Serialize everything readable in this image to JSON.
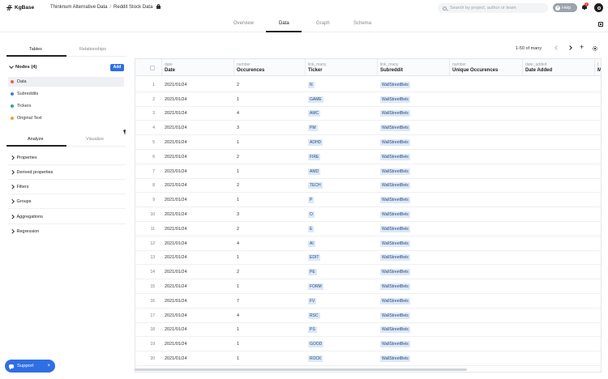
{
  "app": {
    "name": "KgBase"
  },
  "breadcrumb": {
    "project": "Thinknum Alternative Data",
    "separator": "/",
    "dataset": "Reddit Stock Data"
  },
  "search": {
    "placeholder": "Search by project, author or team"
  },
  "help": {
    "label": "Help",
    "icon": "?"
  },
  "notifications": {
    "count": "2"
  },
  "main_tabs": [
    {
      "label": "Overview"
    },
    {
      "label": "Data"
    },
    {
      "label": "Graph"
    },
    {
      "label": "Schema"
    }
  ],
  "main_tabs_active": "Data",
  "panel_tabs": [
    {
      "label": "Tables"
    },
    {
      "label": "Relationships"
    }
  ],
  "nodes": {
    "header": "Nodes (4)",
    "add_label": "Add",
    "items": [
      {
        "label": "Data",
        "color": "#e85d5d"
      },
      {
        "label": "Subreddits",
        "color": "#3f7fd9"
      },
      {
        "label": "Tickers",
        "color": "#2aa3a0"
      },
      {
        "label": "Original Text",
        "color": "#f0a030"
      }
    ]
  },
  "sub_tabs": [
    {
      "label": "Analyze"
    },
    {
      "label": "Visualize"
    }
  ],
  "sections": [
    {
      "label": "Properties"
    },
    {
      "label": "Derived properties"
    },
    {
      "label": "Filters"
    },
    {
      "label": "Groups"
    },
    {
      "label": "Aggregations"
    },
    {
      "label": "Regression"
    }
  ],
  "support": {
    "label": "Support",
    "close": "×"
  },
  "pager": {
    "range": "1-50 of many",
    "add": "+"
  },
  "table": {
    "columns": [
      {
        "type": "date",
        "name": "Date"
      },
      {
        "type": "number",
        "name": "Occurences"
      },
      {
        "type": "link_many",
        "name": "Ticker"
      },
      {
        "type": "link_many",
        "name": "Subreddit"
      },
      {
        "type": "number",
        "name": "Unique Occurences"
      },
      {
        "type": "date_added",
        "name": "Date Added"
      },
      {
        "type": "t",
        "name": "M"
      }
    ],
    "rows": [
      {
        "n": "1",
        "date": "2021/01/24",
        "occ": "2",
        "ticker": "N",
        "sub": "WallStreetBets"
      },
      {
        "n": "2",
        "date": "2021/01/24",
        "occ": "1",
        "ticker": "GAME",
        "sub": "WallStreetBets"
      },
      {
        "n": "3",
        "date": "2021/01/24",
        "occ": "4",
        "ticker": "AMC",
        "sub": "WallStreetBets"
      },
      {
        "n": "4",
        "date": "2021/01/24",
        "occ": "3",
        "ticker": "PM",
        "sub": "WallStreetBets"
      },
      {
        "n": "5",
        "date": "2021/01/24",
        "occ": "1",
        "ticker": "ADHD",
        "sub": "WallStreetBets"
      },
      {
        "n": "6",
        "date": "2021/01/24",
        "occ": "2",
        "ticker": "FIRE",
        "sub": "WallStreetBets"
      },
      {
        "n": "7",
        "date": "2021/01/24",
        "occ": "1",
        "ticker": "AMD",
        "sub": "WallStreetBets"
      },
      {
        "n": "8",
        "date": "2021/01/24",
        "occ": "2",
        "ticker": "TECH",
        "sub": "WallStreetBets"
      },
      {
        "n": "9",
        "date": "2021/01/24",
        "occ": "1",
        "ticker": "P",
        "sub": "WallStreetBets"
      },
      {
        "n": "10",
        "date": "2021/01/24",
        "occ": "3",
        "ticker": "O",
        "sub": "WallStreetBets"
      },
      {
        "n": "11",
        "date": "2021/01/24",
        "occ": "2",
        "ticker": "E",
        "sub": "WallStreetBets"
      },
      {
        "n": "12",
        "date": "2021/01/24",
        "occ": "4",
        "ticker": "AI",
        "sub": "WallStreetBets"
      },
      {
        "n": "13",
        "date": "2021/01/24",
        "occ": "1",
        "ticker": "EDIT",
        "sub": "WallStreetBets"
      },
      {
        "n": "14",
        "date": "2021/01/24",
        "occ": "2",
        "ticker": "PE",
        "sub": "WallStreetBets"
      },
      {
        "n": "15",
        "date": "2021/01/24",
        "occ": "1",
        "ticker": "FORM",
        "sub": "WallStreetBets"
      },
      {
        "n": "16",
        "date": "2021/01/24",
        "occ": "7",
        "ticker": "FV",
        "sub": "WallStreetBets"
      },
      {
        "n": "17",
        "date": "2021/01/24",
        "occ": "4",
        "ticker": "RSC",
        "sub": "WallStreetBets"
      },
      {
        "n": "18",
        "date": "2021/01/24",
        "occ": "1",
        "ticker": "PS",
        "sub": "WallStreetBets"
      },
      {
        "n": "19",
        "date": "2021/01/24",
        "occ": "1",
        "ticker": "GOOD",
        "sub": "WallStreetBets"
      },
      {
        "n": "20",
        "date": "2021/01/24",
        "occ": "1",
        "ticker": "ROCK",
        "sub": "WallStreetBets"
      }
    ]
  }
}
